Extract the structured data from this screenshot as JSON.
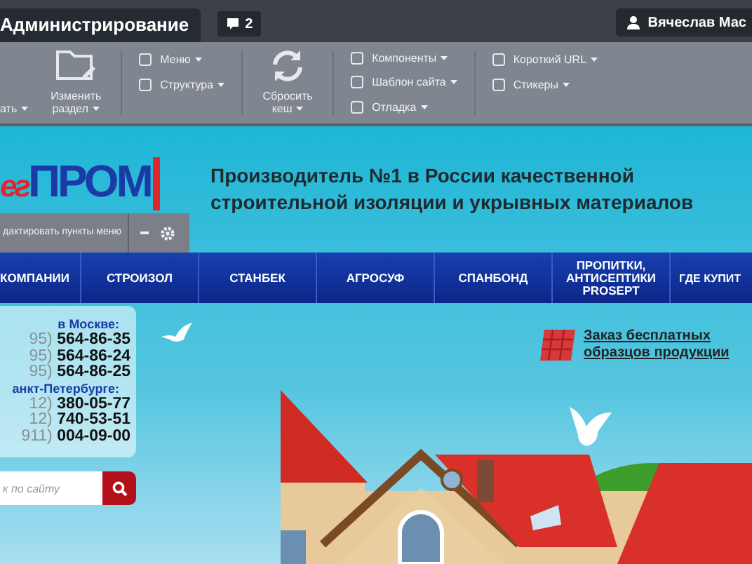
{
  "admin_bar": {
    "title": "Администрирование",
    "notifications": "2",
    "user": "Вячеслав Мас"
  },
  "toolbar": {
    "groups": [
      {
        "kind": "big",
        "label": "ать",
        "caret": true
      },
      {
        "kind": "big",
        "label": "Изменить раздел",
        "caret": true
      },
      {
        "kind": "list",
        "entries": [
          {
            "label": "Меню",
            "caret": true
          },
          {
            "label": "Структура",
            "caret": true
          }
        ]
      },
      {
        "kind": "big",
        "label": "Сбросить кеш",
        "caret": true
      },
      {
        "kind": "list",
        "entries": [
          {
            "label": "Компоненты",
            "caret": true
          },
          {
            "label": "Шаблон сайта",
            "caret": true
          },
          {
            "label": "Отладка",
            "caret": true
          }
        ]
      },
      {
        "kind": "list",
        "entries": [
          {
            "label": "Короткий URL",
            "caret": true
          },
          {
            "label": "Стикеры",
            "caret": true
          }
        ]
      }
    ]
  },
  "site": {
    "logo_left": "ег",
    "logo_right": "ПРОМ",
    "headline": "Производитель №1 в России качественной строительной изоляции и укрывных материалов",
    "edit_menu": "дактировать пункты меню",
    "nav": [
      {
        "label": "КОМПАНИИ"
      },
      {
        "label": "СТРОИЗОЛ"
      },
      {
        "label": "СТАНБЕК"
      },
      {
        "label": "АГРОСУФ"
      },
      {
        "label": "СПАНБОНД"
      },
      {
        "label": "ПРОПИТКИ, АНТИСЕПТИКИ PROSEPT"
      },
      {
        "label": "ГДЕ КУПИТ"
      }
    ],
    "contacts": [
      {
        "city": "в Москве:",
        "phones": [
          {
            "code": "95)",
            "number": "564-86-35"
          },
          {
            "code": "95)",
            "number": "564-86-24"
          },
          {
            "code": "95)",
            "number": "564-86-25"
          }
        ]
      },
      {
        "city": "анкт-Петербурге:",
        "phones": [
          {
            "code": "12)",
            "number": "380-05-77"
          },
          {
            "code": "12)",
            "number": "740-53-51"
          },
          {
            "code": "911)",
            "number": "004-09-00"
          }
        ]
      }
    ],
    "search": {
      "placeholder": "к по сайту"
    },
    "promo_link": "Заказ бесплатных образцов продукции"
  }
}
